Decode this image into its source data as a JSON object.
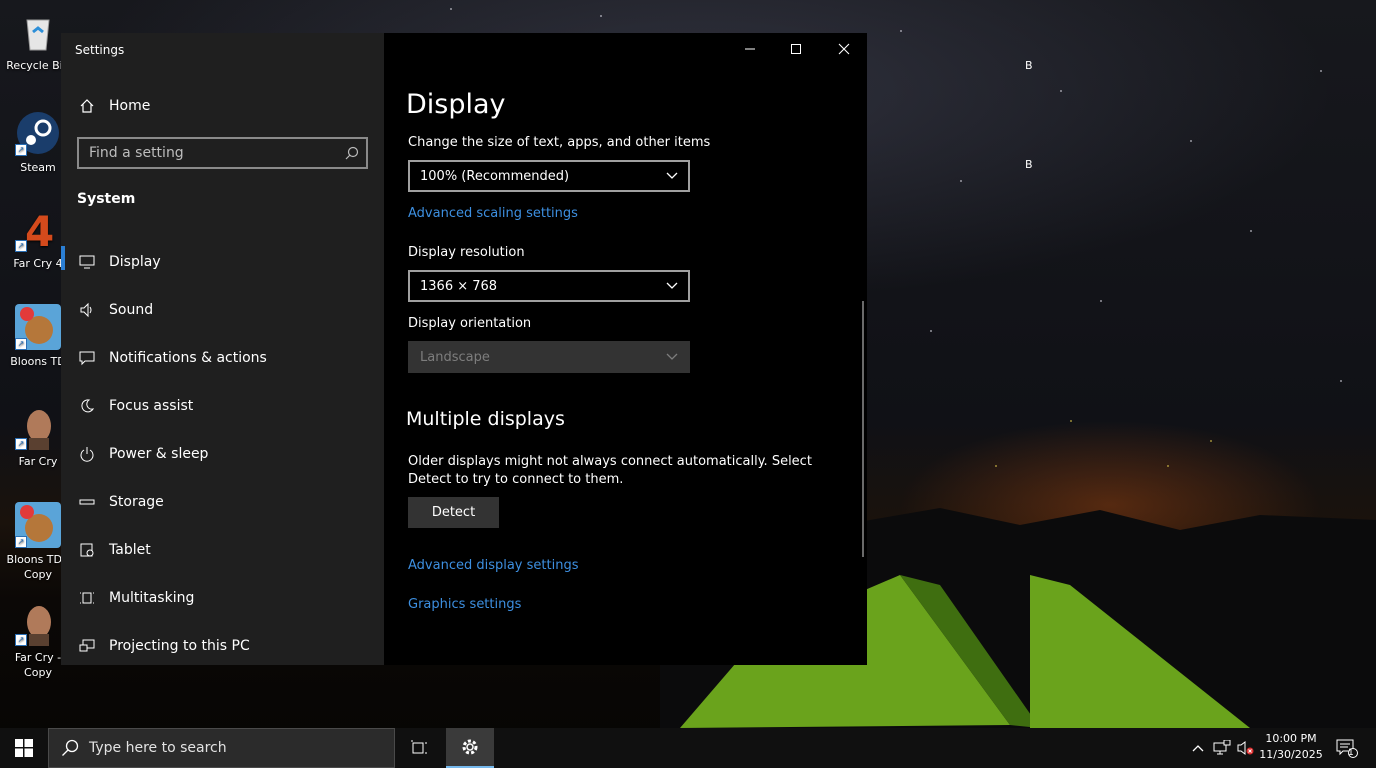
{
  "desktop": {
    "icons": [
      {
        "label": "Recycle Bin",
        "icon": "recycle-bin-icon"
      },
      {
        "label": "Steam",
        "icon": "steam-icon"
      },
      {
        "label": "Far Cry 4",
        "icon": "far-cry-4-icon"
      },
      {
        "label": "Bloons TD",
        "icon": "bloons-td-icon"
      },
      {
        "label": "Far Cry",
        "icon": "far-cry-icon"
      },
      {
        "label": "Bloons TD - Copy",
        "icon": "bloons-td-icon"
      },
      {
        "label": "Far Cry - Copy",
        "icon": "far-cry-icon"
      }
    ],
    "ghost_labels": [
      "B",
      "B"
    ]
  },
  "window": {
    "title": "Settings",
    "controls": {
      "minimize": "minimize-icon",
      "maximize": "maximize-icon",
      "close": "close-icon"
    }
  },
  "sidebar": {
    "home_label": "Home",
    "search_placeholder": "Find a setting",
    "section_label": "System",
    "items": [
      {
        "label": "Display",
        "icon": "monitor-icon",
        "active": true
      },
      {
        "label": "Sound",
        "icon": "speaker-icon"
      },
      {
        "label": "Notifications & actions",
        "icon": "message-icon"
      },
      {
        "label": "Focus assist",
        "icon": "moon-icon"
      },
      {
        "label": "Power & sleep",
        "icon": "power-icon"
      },
      {
        "label": "Storage",
        "icon": "storage-icon"
      },
      {
        "label": "Tablet",
        "icon": "tablet-icon"
      },
      {
        "label": "Multitasking",
        "icon": "multitasking-icon"
      },
      {
        "label": "Projecting to this PC",
        "icon": "projecting-icon"
      }
    ]
  },
  "main": {
    "title": "Display",
    "scale_label": "Change the size of text, apps, and other items",
    "scale_value": "100% (Recommended)",
    "advanced_scaling_link": "Advanced scaling settings",
    "resolution_label": "Display resolution",
    "resolution_value": "1366 × 768",
    "orientation_label": "Display orientation",
    "orientation_value": "Landscape",
    "multiple_displays_heading": "Multiple displays",
    "multiple_displays_text": "Older displays might not always connect automatically. Select Detect to try to connect to them.",
    "detect_button": "Detect",
    "advanced_display_link": "Advanced display settings",
    "graphics_link": "Graphics settings"
  },
  "taskbar": {
    "search_placeholder": "Type here to search",
    "time": "10:00 PM",
    "date": "11/30/2025",
    "notification_count": "1",
    "accent_color": "#76b9ed"
  }
}
